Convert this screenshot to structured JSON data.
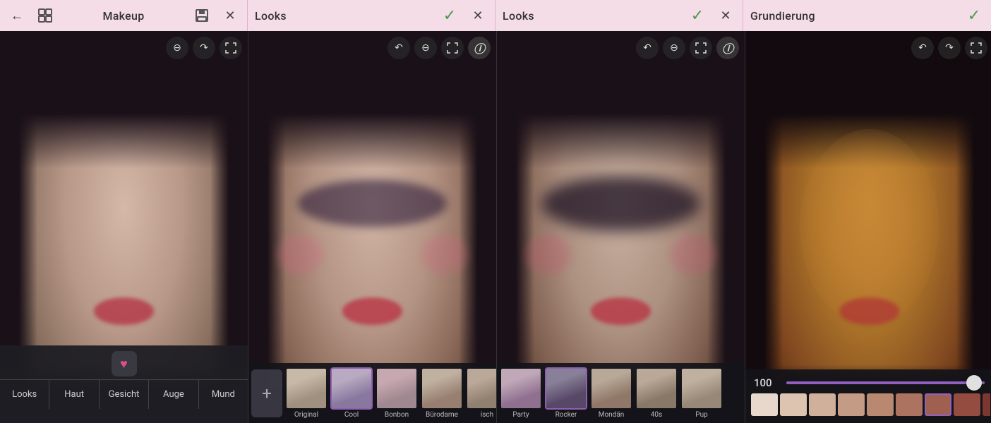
{
  "topbar": {
    "section1": {
      "title": "Makeup",
      "back_label": "back",
      "grid_label": "grid",
      "close_label": "close"
    },
    "section2": {
      "title": "Looks",
      "check_label": "confirm",
      "close_label": "close"
    },
    "section3": {
      "title": "Looks",
      "check_label": "confirm",
      "close_label": "close"
    },
    "section4": {
      "title": "Grundierung",
      "check_label": "confirm"
    }
  },
  "panels": {
    "panel1": {
      "controls": [
        "minus",
        "redo",
        "crop"
      ]
    },
    "panel2": {
      "controls": [
        "undo",
        "minus",
        "crop",
        "info"
      ]
    },
    "panel3": {
      "controls": [
        "undo",
        "minus",
        "crop",
        "info"
      ]
    },
    "panel4": {
      "controls": [
        "undo",
        "redo",
        "crop"
      ]
    }
  },
  "looks_carousel": {
    "items": [
      {
        "label": "Original",
        "selected": false
      },
      {
        "label": "Cool",
        "selected": true
      },
      {
        "label": "Bonbon",
        "selected": false
      },
      {
        "label": "Bürodame",
        "selected": false
      },
      {
        "label": "isch",
        "selected": false
      },
      {
        "label": "Party",
        "selected": false
      },
      {
        "label": "Rocker",
        "selected": true
      },
      {
        "label": "Mondän",
        "selected": false
      },
      {
        "label": "40s",
        "selected": false
      },
      {
        "label": "Pup",
        "selected": false
      }
    ]
  },
  "category_tabs": [
    "Looks",
    "Haut",
    "Gesicht",
    "Auge",
    "Mund"
  ],
  "foundation": {
    "slider_value": "100",
    "swatches": [
      "#e8d8cc",
      "#dcc4b0",
      "#d0b09a",
      "#c49c86",
      "#b88870",
      "#ac7460",
      "#a06050",
      "#944c40",
      "#7a3830"
    ],
    "selected_swatch": 6
  },
  "icons": {
    "back": "←",
    "check": "✓",
    "close": "✕",
    "grid": "⊞",
    "minus": "⊖",
    "redo": "↷",
    "undo": "↶",
    "crop": "⬡",
    "info": "ⓘ",
    "plus": "+",
    "heart": "♥"
  }
}
